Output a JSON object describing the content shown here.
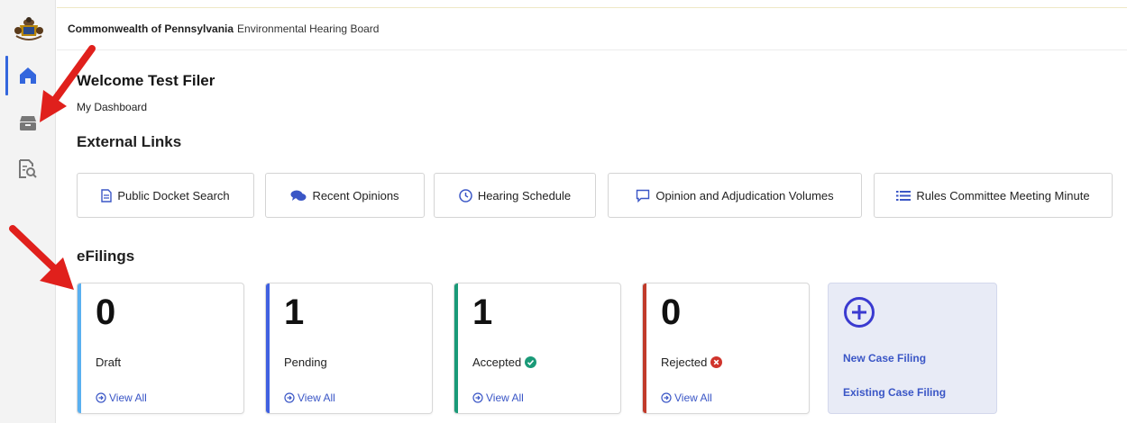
{
  "header": {
    "org": "Commonwealth of Pennsylvania",
    "board": "Environmental Hearing Board"
  },
  "sidebar": {
    "items": [
      {
        "name": "home",
        "icon": "home-icon",
        "active": true
      },
      {
        "name": "inbox",
        "icon": "inbox-icon",
        "active": false
      },
      {
        "name": "docket-search",
        "icon": "document-search-icon",
        "active": false
      }
    ]
  },
  "main": {
    "welcome": "Welcome Test Filer",
    "subtitle": "My Dashboard",
    "external_links_title": "External Links",
    "external_links": [
      {
        "label": "Public Docket Search",
        "icon": "file-icon"
      },
      {
        "label": "Recent Opinions",
        "icon": "comments-icon"
      },
      {
        "label": "Hearing Schedule",
        "icon": "clock-icon"
      },
      {
        "label": "Opinion and Adjudication Volumes",
        "icon": "message-icon"
      },
      {
        "label": "Rules Committee Meeting Minute",
        "icon": "list-icon"
      }
    ],
    "efilings_title": "eFilings",
    "efilings": [
      {
        "count": "0",
        "label": "Draft",
        "view": "View All",
        "accent": "#5ab0f0"
      },
      {
        "count": "1",
        "label": "Pending",
        "view": "View All",
        "accent": "#4060e0"
      },
      {
        "count": "1",
        "label": "Accepted",
        "view": "View All",
        "accent": "#1a9a78",
        "status_icon": "check-circle-icon"
      },
      {
        "count": "0",
        "label": "Rejected",
        "view": "View All",
        "accent": "#c03a2a",
        "status_icon": "x-circle-icon"
      }
    ],
    "new_filing": {
      "new_case": "New Case Filing",
      "existing_case": "Existing Case Filing"
    }
  },
  "colors": {
    "link_blue": "#3a56c6",
    "arrow_red": "#e0201c"
  }
}
